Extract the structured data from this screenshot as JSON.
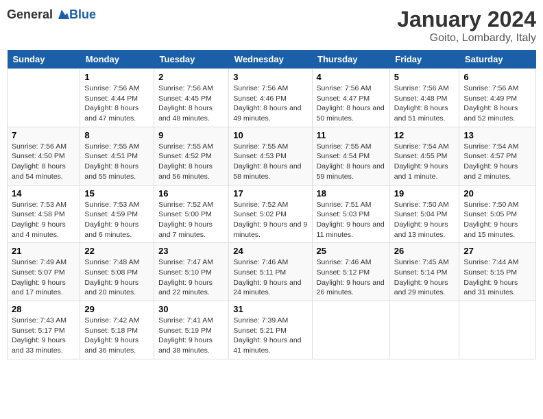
{
  "header": {
    "logo_general": "General",
    "logo_blue": "Blue",
    "title": "January 2024",
    "subtitle": "Goito, Lombardy, Italy"
  },
  "days": [
    "Sunday",
    "Monday",
    "Tuesday",
    "Wednesday",
    "Thursday",
    "Friday",
    "Saturday"
  ],
  "weeks": [
    [
      {
        "date": "",
        "sunrise": "",
        "sunset": "",
        "daylight": ""
      },
      {
        "date": "1",
        "sunrise": "Sunrise: 7:56 AM",
        "sunset": "Sunset: 4:44 PM",
        "daylight": "Daylight: 8 hours and 47 minutes."
      },
      {
        "date": "2",
        "sunrise": "Sunrise: 7:56 AM",
        "sunset": "Sunset: 4:45 PM",
        "daylight": "Daylight: 8 hours and 48 minutes."
      },
      {
        "date": "3",
        "sunrise": "Sunrise: 7:56 AM",
        "sunset": "Sunset: 4:46 PM",
        "daylight": "Daylight: 8 hours and 49 minutes."
      },
      {
        "date": "4",
        "sunrise": "Sunrise: 7:56 AM",
        "sunset": "Sunset: 4:47 PM",
        "daylight": "Daylight: 8 hours and 50 minutes."
      },
      {
        "date": "5",
        "sunrise": "Sunrise: 7:56 AM",
        "sunset": "Sunset: 4:48 PM",
        "daylight": "Daylight: 8 hours and 51 minutes."
      },
      {
        "date": "6",
        "sunrise": "Sunrise: 7:56 AM",
        "sunset": "Sunset: 4:49 PM",
        "daylight": "Daylight: 8 hours and 52 minutes."
      }
    ],
    [
      {
        "date": "7",
        "sunrise": "Sunrise: 7:56 AM",
        "sunset": "Sunset: 4:50 PM",
        "daylight": "Daylight: 8 hours and 54 minutes."
      },
      {
        "date": "8",
        "sunrise": "Sunrise: 7:55 AM",
        "sunset": "Sunset: 4:51 PM",
        "daylight": "Daylight: 8 hours and 55 minutes."
      },
      {
        "date": "9",
        "sunrise": "Sunrise: 7:55 AM",
        "sunset": "Sunset: 4:52 PM",
        "daylight": "Daylight: 8 hours and 56 minutes."
      },
      {
        "date": "10",
        "sunrise": "Sunrise: 7:55 AM",
        "sunset": "Sunset: 4:53 PM",
        "daylight": "Daylight: 8 hours and 58 minutes."
      },
      {
        "date": "11",
        "sunrise": "Sunrise: 7:55 AM",
        "sunset": "Sunset: 4:54 PM",
        "daylight": "Daylight: 8 hours and 59 minutes."
      },
      {
        "date": "12",
        "sunrise": "Sunrise: 7:54 AM",
        "sunset": "Sunset: 4:55 PM",
        "daylight": "Daylight: 9 hours and 1 minute."
      },
      {
        "date": "13",
        "sunrise": "Sunrise: 7:54 AM",
        "sunset": "Sunset: 4:57 PM",
        "daylight": "Daylight: 9 hours and 2 minutes."
      }
    ],
    [
      {
        "date": "14",
        "sunrise": "Sunrise: 7:53 AM",
        "sunset": "Sunset: 4:58 PM",
        "daylight": "Daylight: 9 hours and 4 minutes."
      },
      {
        "date": "15",
        "sunrise": "Sunrise: 7:53 AM",
        "sunset": "Sunset: 4:59 PM",
        "daylight": "Daylight: 9 hours and 6 minutes."
      },
      {
        "date": "16",
        "sunrise": "Sunrise: 7:52 AM",
        "sunset": "Sunset: 5:00 PM",
        "daylight": "Daylight: 9 hours and 7 minutes."
      },
      {
        "date": "17",
        "sunrise": "Sunrise: 7:52 AM",
        "sunset": "Sunset: 5:02 PM",
        "daylight": "Daylight: 9 hours and 9 minutes."
      },
      {
        "date": "18",
        "sunrise": "Sunrise: 7:51 AM",
        "sunset": "Sunset: 5:03 PM",
        "daylight": "Daylight: 9 hours and 11 minutes."
      },
      {
        "date": "19",
        "sunrise": "Sunrise: 7:50 AM",
        "sunset": "Sunset: 5:04 PM",
        "daylight": "Daylight: 9 hours and 13 minutes."
      },
      {
        "date": "20",
        "sunrise": "Sunrise: 7:50 AM",
        "sunset": "Sunset: 5:05 PM",
        "daylight": "Daylight: 9 hours and 15 minutes."
      }
    ],
    [
      {
        "date": "21",
        "sunrise": "Sunrise: 7:49 AM",
        "sunset": "Sunset: 5:07 PM",
        "daylight": "Daylight: 9 hours and 17 minutes."
      },
      {
        "date": "22",
        "sunrise": "Sunrise: 7:48 AM",
        "sunset": "Sunset: 5:08 PM",
        "daylight": "Daylight: 9 hours and 20 minutes."
      },
      {
        "date": "23",
        "sunrise": "Sunrise: 7:47 AM",
        "sunset": "Sunset: 5:10 PM",
        "daylight": "Daylight: 9 hours and 22 minutes."
      },
      {
        "date": "24",
        "sunrise": "Sunrise: 7:46 AM",
        "sunset": "Sunset: 5:11 PM",
        "daylight": "Daylight: 9 hours and 24 minutes."
      },
      {
        "date": "25",
        "sunrise": "Sunrise: 7:46 AM",
        "sunset": "Sunset: 5:12 PM",
        "daylight": "Daylight: 9 hours and 26 minutes."
      },
      {
        "date": "26",
        "sunrise": "Sunrise: 7:45 AM",
        "sunset": "Sunset: 5:14 PM",
        "daylight": "Daylight: 9 hours and 29 minutes."
      },
      {
        "date": "27",
        "sunrise": "Sunrise: 7:44 AM",
        "sunset": "Sunset: 5:15 PM",
        "daylight": "Daylight: 9 hours and 31 minutes."
      }
    ],
    [
      {
        "date": "28",
        "sunrise": "Sunrise: 7:43 AM",
        "sunset": "Sunset: 5:17 PM",
        "daylight": "Daylight: 9 hours and 33 minutes."
      },
      {
        "date": "29",
        "sunrise": "Sunrise: 7:42 AM",
        "sunset": "Sunset: 5:18 PM",
        "daylight": "Daylight: 9 hours and 36 minutes."
      },
      {
        "date": "30",
        "sunrise": "Sunrise: 7:41 AM",
        "sunset": "Sunset: 5:19 PM",
        "daylight": "Daylight: 9 hours and 38 minutes."
      },
      {
        "date": "31",
        "sunrise": "Sunrise: 7:39 AM",
        "sunset": "Sunset: 5:21 PM",
        "daylight": "Daylight: 9 hours and 41 minutes."
      },
      {
        "date": "",
        "sunrise": "",
        "sunset": "",
        "daylight": ""
      },
      {
        "date": "",
        "sunrise": "",
        "sunset": "",
        "daylight": ""
      },
      {
        "date": "",
        "sunrise": "",
        "sunset": "",
        "daylight": ""
      }
    ]
  ]
}
